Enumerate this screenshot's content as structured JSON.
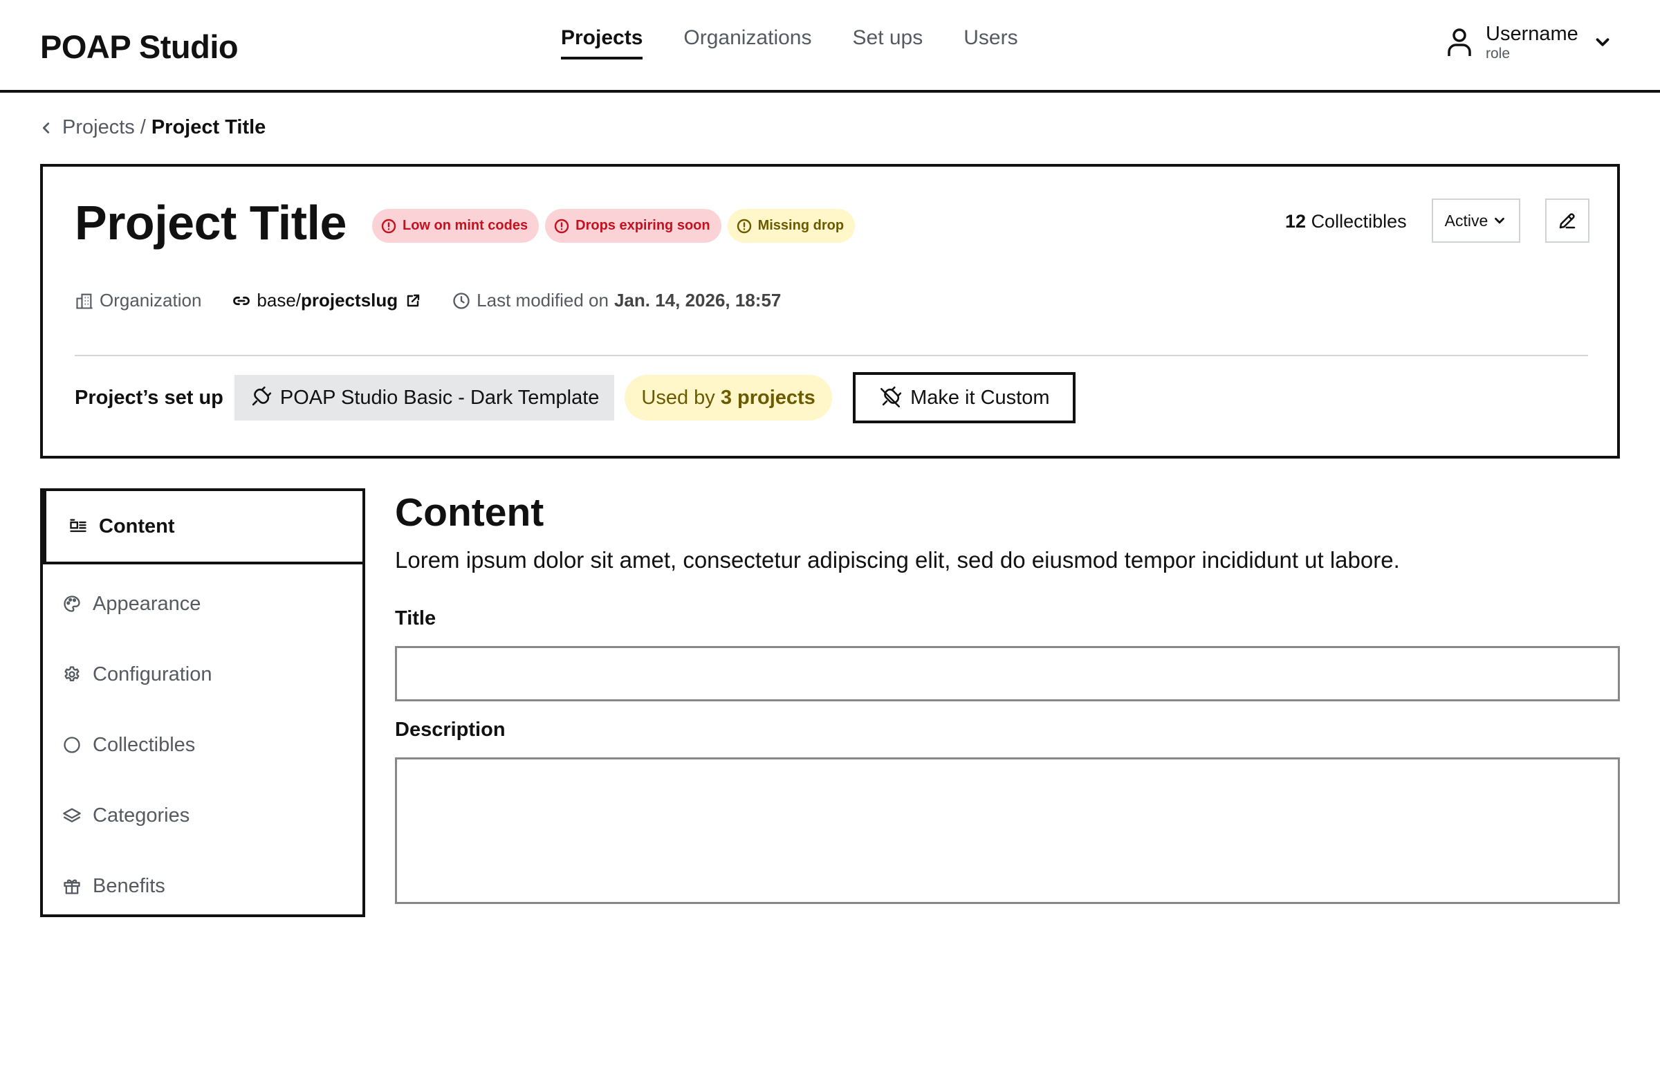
{
  "app": {
    "brand": "POAP Studio"
  },
  "nav": {
    "items": [
      {
        "label": "Projects",
        "active": true
      },
      {
        "label": "Organizations",
        "active": false
      },
      {
        "label": "Set ups",
        "active": false
      },
      {
        "label": "Users",
        "active": false
      }
    ]
  },
  "user": {
    "name": "Username",
    "role": "role",
    "icon": "user-icon"
  },
  "breadcrumb": {
    "parent": "Projects",
    "separator": "/",
    "current": "Project Title"
  },
  "project": {
    "title": "Project Title",
    "badges": [
      {
        "label": "Low on mint codes",
        "tone": "error",
        "color": "#c4111f",
        "background": "#fbd3d7"
      },
      {
        "label": "Drops expiring soon",
        "tone": "error",
        "color": "#c4111f",
        "background": "#fbd3d7"
      },
      {
        "label": "Missing drop",
        "tone": "warning",
        "color": "#6b5a00",
        "background": "#fff6c9"
      }
    ],
    "collectibles_count": "12",
    "collectibles_label": "Collectibles",
    "status": "Active",
    "meta": {
      "organization": "Organization",
      "slug_base": "base/",
      "slug": "projectslug",
      "modified_label": "Last modified on",
      "modified_value": "Jan. 14, 2026, 18:57"
    },
    "setup": {
      "label": "Project’s set up",
      "template": "POAP Studio Basic - Dark Template",
      "used_by_prefix": "Used by",
      "used_by_value": "3 projects",
      "custom_button": "Make it Custom"
    }
  },
  "sidebar": {
    "items": [
      {
        "label": "Content",
        "icon": "content-icon",
        "active": true
      },
      {
        "label": "Appearance",
        "icon": "palette-icon",
        "active": false
      },
      {
        "label": "Configuration",
        "icon": "gear-icon",
        "active": false
      },
      {
        "label": "Collectibles",
        "icon": "circle-icon",
        "active": false
      },
      {
        "label": "Categories",
        "icon": "layers-icon",
        "active": false
      },
      {
        "label": "Benefits",
        "icon": "gift-icon",
        "active": false
      }
    ]
  },
  "content": {
    "title": "Content",
    "description": "Lorem ipsum dolor sit amet, consectetur adipiscing elit, sed do eiusmod tempor incididunt ut labore.",
    "title_field": {
      "label": "Title",
      "value": ""
    },
    "description_field": {
      "label": "Description",
      "value": ""
    }
  },
  "colors": {
    "text": "#111111",
    "muted": "#555a60",
    "error_bg": "#fbd3d7",
    "error_text": "#c4111f",
    "warning_bg": "#fff6c9",
    "warning_text": "#6b5a00"
  }
}
